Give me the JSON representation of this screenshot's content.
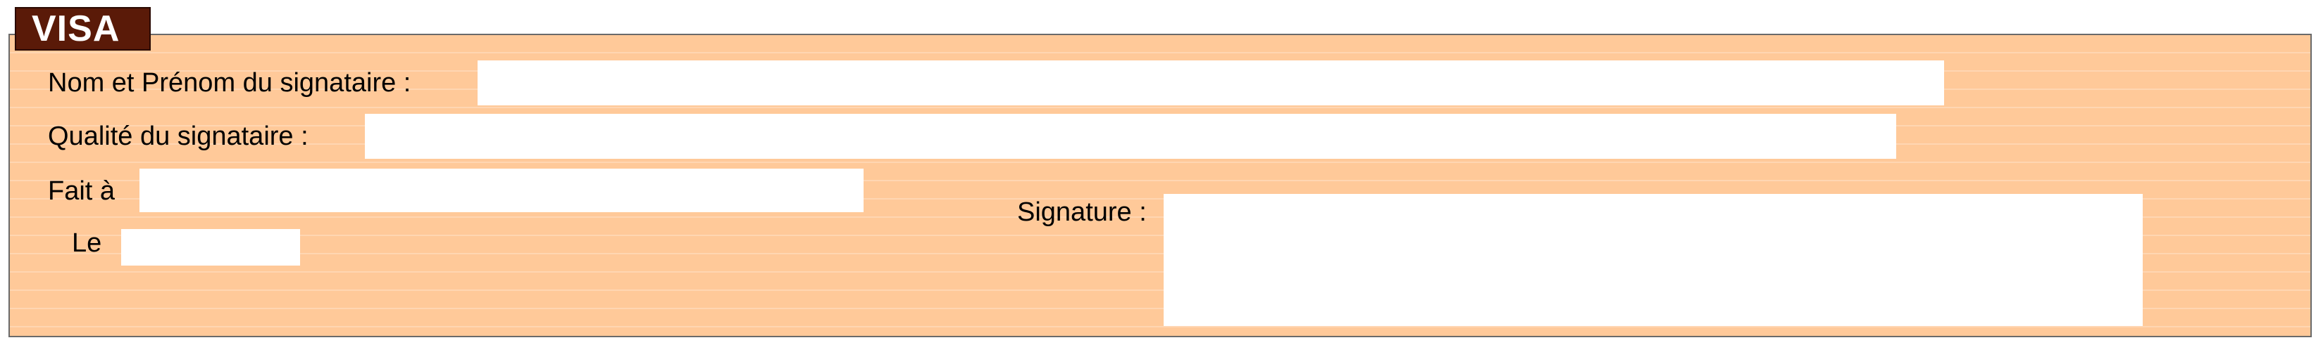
{
  "section": {
    "title": "VISA"
  },
  "form": {
    "signatory_name_label": "Nom et Prénom du signataire :",
    "signatory_name_value": "",
    "signatory_quality_label": "Qualité du signataire :",
    "signatory_quality_value": "",
    "place_label": "Fait à",
    "place_value": "",
    "date_label": "Le",
    "date_value": "",
    "signature_label": "Signature :"
  },
  "colors": {
    "panel_background": "#ffc999",
    "tab_background": "#5a1a08",
    "field_background": "#ffffff"
  }
}
